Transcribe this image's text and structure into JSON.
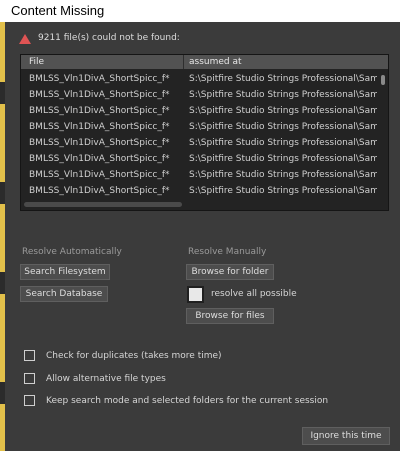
{
  "window": {
    "title": "Content Missing"
  },
  "warning": {
    "icon": "warning-triangle-icon",
    "color": "#e05454",
    "message": "9211 file(s) could not be found:"
  },
  "table": {
    "columns": [
      "File",
      "assumed at"
    ],
    "rows": [
      [
        "BMLSS_Vln1DivA_ShortSpicc_f*",
        "S:\\Spitfire Studio Strings Professional\\Samp"
      ],
      [
        "BMLSS_Vln1DivA_ShortSpicc_f*",
        "S:\\Spitfire Studio Strings Professional\\Samp"
      ],
      [
        "BMLSS_Vln1DivA_ShortSpicc_f*",
        "S:\\Spitfire Studio Strings Professional\\Samp"
      ],
      [
        "BMLSS_Vln1DivA_ShortSpicc_f*",
        "S:\\Spitfire Studio Strings Professional\\Samp"
      ],
      [
        "BMLSS_Vln1DivA_ShortSpicc_f*",
        "S:\\Spitfire Studio Strings Professional\\Samp"
      ],
      [
        "BMLSS_Vln1DivA_ShortSpicc_f*",
        "S:\\Spitfire Studio Strings Professional\\Samp"
      ],
      [
        "BMLSS_Vln1DivA_ShortSpicc_f*",
        "S:\\Spitfire Studio Strings Professional\\Samp"
      ],
      [
        "BMLSS_Vln1DivA_ShortSpicc_f*",
        "S:\\Spitfire Studio Strings Professional\\Samp"
      ]
    ]
  },
  "resolve_auto": {
    "label": "Resolve Automatically",
    "search_filesystem": "Search Filesystem",
    "search_database": "Search Database"
  },
  "resolve_manual": {
    "label": "Resolve Manually",
    "browse_folder": "Browse for folder",
    "resolve_all": {
      "label": "resolve all possible",
      "checked": true
    },
    "browse_files": "Browse for files"
  },
  "options": [
    {
      "label": "Check for duplicates (takes more time)",
      "checked": false
    },
    {
      "label": "Allow alternative file types",
      "checked": false
    },
    {
      "label": "Keep search mode and selected folders for the current session",
      "checked": false
    }
  ],
  "footer": {
    "ignore_button": "Ignore this time"
  }
}
